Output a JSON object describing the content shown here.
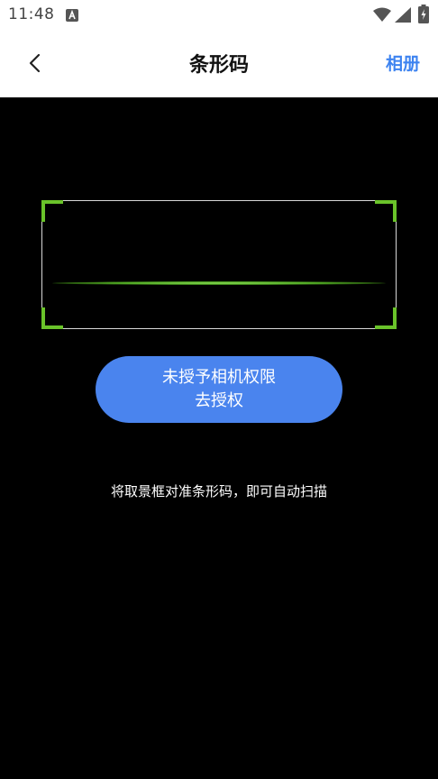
{
  "status_bar": {
    "time": "11:48",
    "icons": [
      "a-notification-icon",
      "wifi-icon",
      "signal-icon",
      "battery-charging-icon"
    ]
  },
  "navbar": {
    "back_icon": "chevron-left-icon",
    "title": "条形码",
    "album_label": "相册"
  },
  "scanner": {
    "frame_corner_color": "#6ac32a",
    "scan_line_color": "#8fe05a"
  },
  "permission_button": {
    "line1": "未授予相机权限",
    "line2": "去授权",
    "color": "#4a84ee"
  },
  "hint": "将取景框对准条形码，即可自动扫描",
  "colors": {
    "accent": "#3d83f0",
    "background": "#000000"
  }
}
